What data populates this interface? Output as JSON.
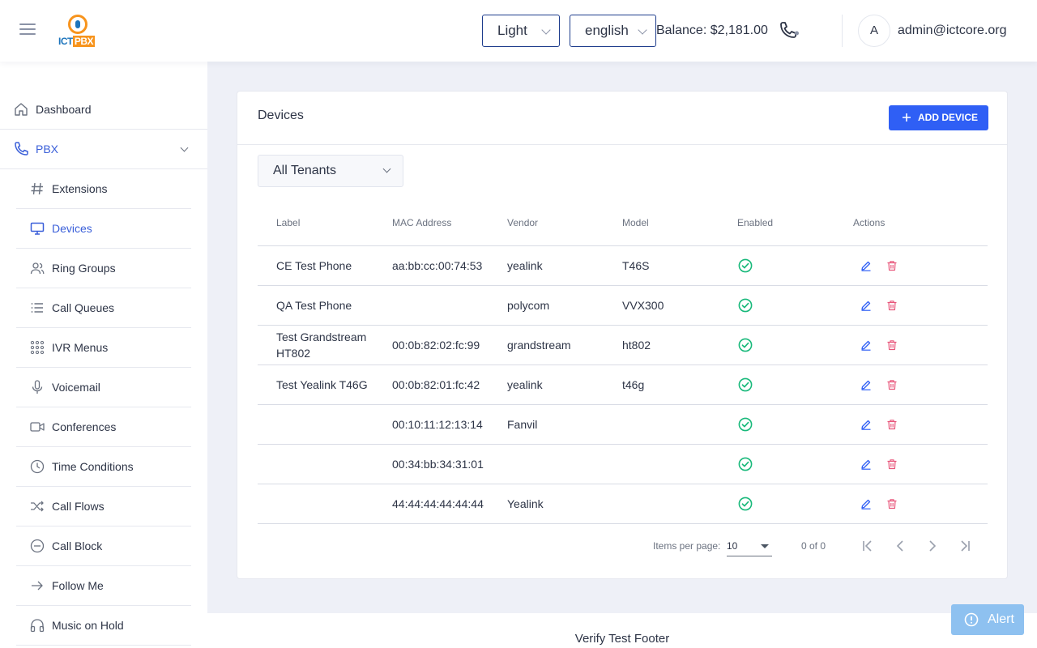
{
  "header": {
    "logo_text_ict": "ICT",
    "logo_text_pbx": "PBX",
    "theme_value": "Light",
    "language_value": "english",
    "balance": "Balance: $2,181.00",
    "avatar_initial": "A",
    "user_email": "admin@ictcore.org"
  },
  "sidebar": {
    "dashboard": "Dashboard",
    "pbx": "PBX",
    "items": [
      {
        "label": "Extensions"
      },
      {
        "label": "Devices"
      },
      {
        "label": "Ring Groups"
      },
      {
        "label": "Call Queues"
      },
      {
        "label": "IVR Menus"
      },
      {
        "label": "Voicemail"
      },
      {
        "label": "Conferences"
      },
      {
        "label": "Time Conditions"
      },
      {
        "label": "Call Flows"
      },
      {
        "label": "Call Block"
      },
      {
        "label": "Follow Me"
      },
      {
        "label": "Music on Hold"
      }
    ]
  },
  "card": {
    "title": "Devices",
    "add_button": "ADD DEVICE",
    "tenant_filter": "All Tenants"
  },
  "table": {
    "headers": {
      "label": "Label",
      "mac": "MAC Address",
      "vendor": "Vendor",
      "model": "Model",
      "enabled": "Enabled",
      "actions": "Actions"
    },
    "rows": [
      {
        "label": "CE Test Phone",
        "mac": "aa:bb:cc:00:74:53",
        "vendor": "yealink",
        "model": "T46S",
        "enabled": true
      },
      {
        "label": "QA Test Phone",
        "mac": "",
        "vendor": "polycom",
        "model": "VVX300",
        "enabled": true
      },
      {
        "label": "Test Grandstream HT802",
        "mac": "00:0b:82:02:fc:99",
        "vendor": "grandstream",
        "model": "ht802",
        "enabled": true
      },
      {
        "label": "Test Yealink T46G",
        "mac": "00:0b:82:01:fc:42",
        "vendor": "yealink",
        "model": "t46g",
        "enabled": true
      },
      {
        "label": "",
        "mac": "00:10:11:12:13:14",
        "vendor": "Fanvil",
        "model": "",
        "enabled": true
      },
      {
        "label": "",
        "mac": "00:34:bb:34:31:01",
        "vendor": "",
        "model": "",
        "enabled": true
      },
      {
        "label": "",
        "mac": "44:44:44:44:44:44",
        "vendor": "Yealink",
        "model": "",
        "enabled": true
      }
    ]
  },
  "pager": {
    "items_per_page_label": "Items per page:",
    "items_per_page_value": "10",
    "range": "0 of 0"
  },
  "footer": {
    "text": "Verify Test Footer"
  },
  "alert": {
    "label": "Alert"
  },
  "colors": {
    "primary": "#2f5ff5",
    "active_nav": "#3a5fd9",
    "enabled_green": "#19b97b",
    "delete_red": "#e8557a",
    "edit_blue": "#2f5ff5"
  }
}
